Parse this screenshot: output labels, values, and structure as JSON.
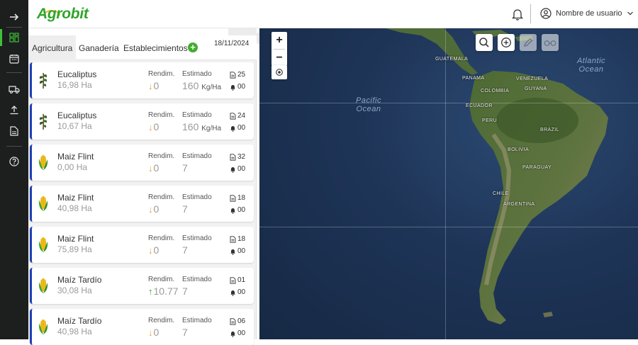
{
  "app": {
    "brand": "Agrobit",
    "brand_color": "#2fa52b"
  },
  "sidebar": {
    "items": [
      {
        "icon": "arrow-right-icon"
      },
      {
        "icon": "dashboard-icon",
        "active": true
      },
      {
        "icon": "calendar-icon"
      },
      {
        "icon": "truck-icon"
      },
      {
        "icon": "upload-icon"
      },
      {
        "icon": "document-icon"
      },
      {
        "icon": "help-icon"
      }
    ]
  },
  "header": {
    "user_name": "Nombre de usuario"
  },
  "panel": {
    "date": "18/11/2024",
    "tabs": [
      {
        "label": "Agricultura",
        "active": true
      },
      {
        "label": "Ganadería"
      },
      {
        "label": "Establecimientos"
      }
    ],
    "rend_label": "Rendim.",
    "est_label": "Estimado",
    "cards": [
      {
        "crop": "Eucaliptus",
        "icon": "eucalyptus-icon",
        "area": "16,98 Ha",
        "rend": "0",
        "trend": "down",
        "est": "160",
        "unit": "Kg/Ha",
        "docs": "25",
        "alerts": "00"
      },
      {
        "crop": "Eucaliptus",
        "icon": "eucalyptus-icon",
        "area": "10,67 Ha",
        "rend": "0",
        "trend": "down",
        "est": "160",
        "unit": "Kg/Ha",
        "docs": "24",
        "alerts": "00"
      },
      {
        "crop": "Maiz Flint",
        "icon": "corn-icon",
        "area": "0,00 Ha",
        "rend": "0",
        "trend": "down",
        "est": "7",
        "unit": "",
        "docs": "32",
        "alerts": "00"
      },
      {
        "crop": "Maiz Flint",
        "icon": "corn-icon",
        "area": "40,98 Ha",
        "rend": "0",
        "trend": "down",
        "est": "7",
        "unit": "",
        "docs": "18",
        "alerts": "00"
      },
      {
        "crop": "Maiz Flint",
        "icon": "corn-icon",
        "area": "75,89 Ha",
        "rend": "0",
        "trend": "down",
        "est": "7",
        "unit": "",
        "docs": "18",
        "alerts": "00"
      },
      {
        "crop": "Maíz Tardío",
        "icon": "corn-icon",
        "area": "30,08 Ha",
        "rend": "10.77",
        "trend": "up",
        "est": "7",
        "unit": "",
        "docs": "01",
        "alerts": "00"
      },
      {
        "crop": "Maíz Tardío",
        "icon": "corn-icon",
        "area": "40,98 Ha",
        "rend": "0",
        "trend": "down",
        "est": "7",
        "unit": "",
        "docs": "06",
        "alerts": "00"
      }
    ]
  },
  "map": {
    "oceans": [
      {
        "label": "Pacific Ocean"
      },
      {
        "label": "Atlantic Ocean"
      }
    ],
    "countries": [
      "GUATEMALA",
      "PANAMA",
      "COLOMBIA",
      "ECUADOR",
      "VENEZUELA",
      "GUYANA",
      "PERU",
      "BRAZIL",
      "BOLIVIA",
      "PARAGUAY",
      "CHILE",
      "ARGENTINA"
    ],
    "tools": [
      "search-icon",
      "add-circle-icon",
      "pencil-icon",
      "glasses-icon"
    ]
  }
}
